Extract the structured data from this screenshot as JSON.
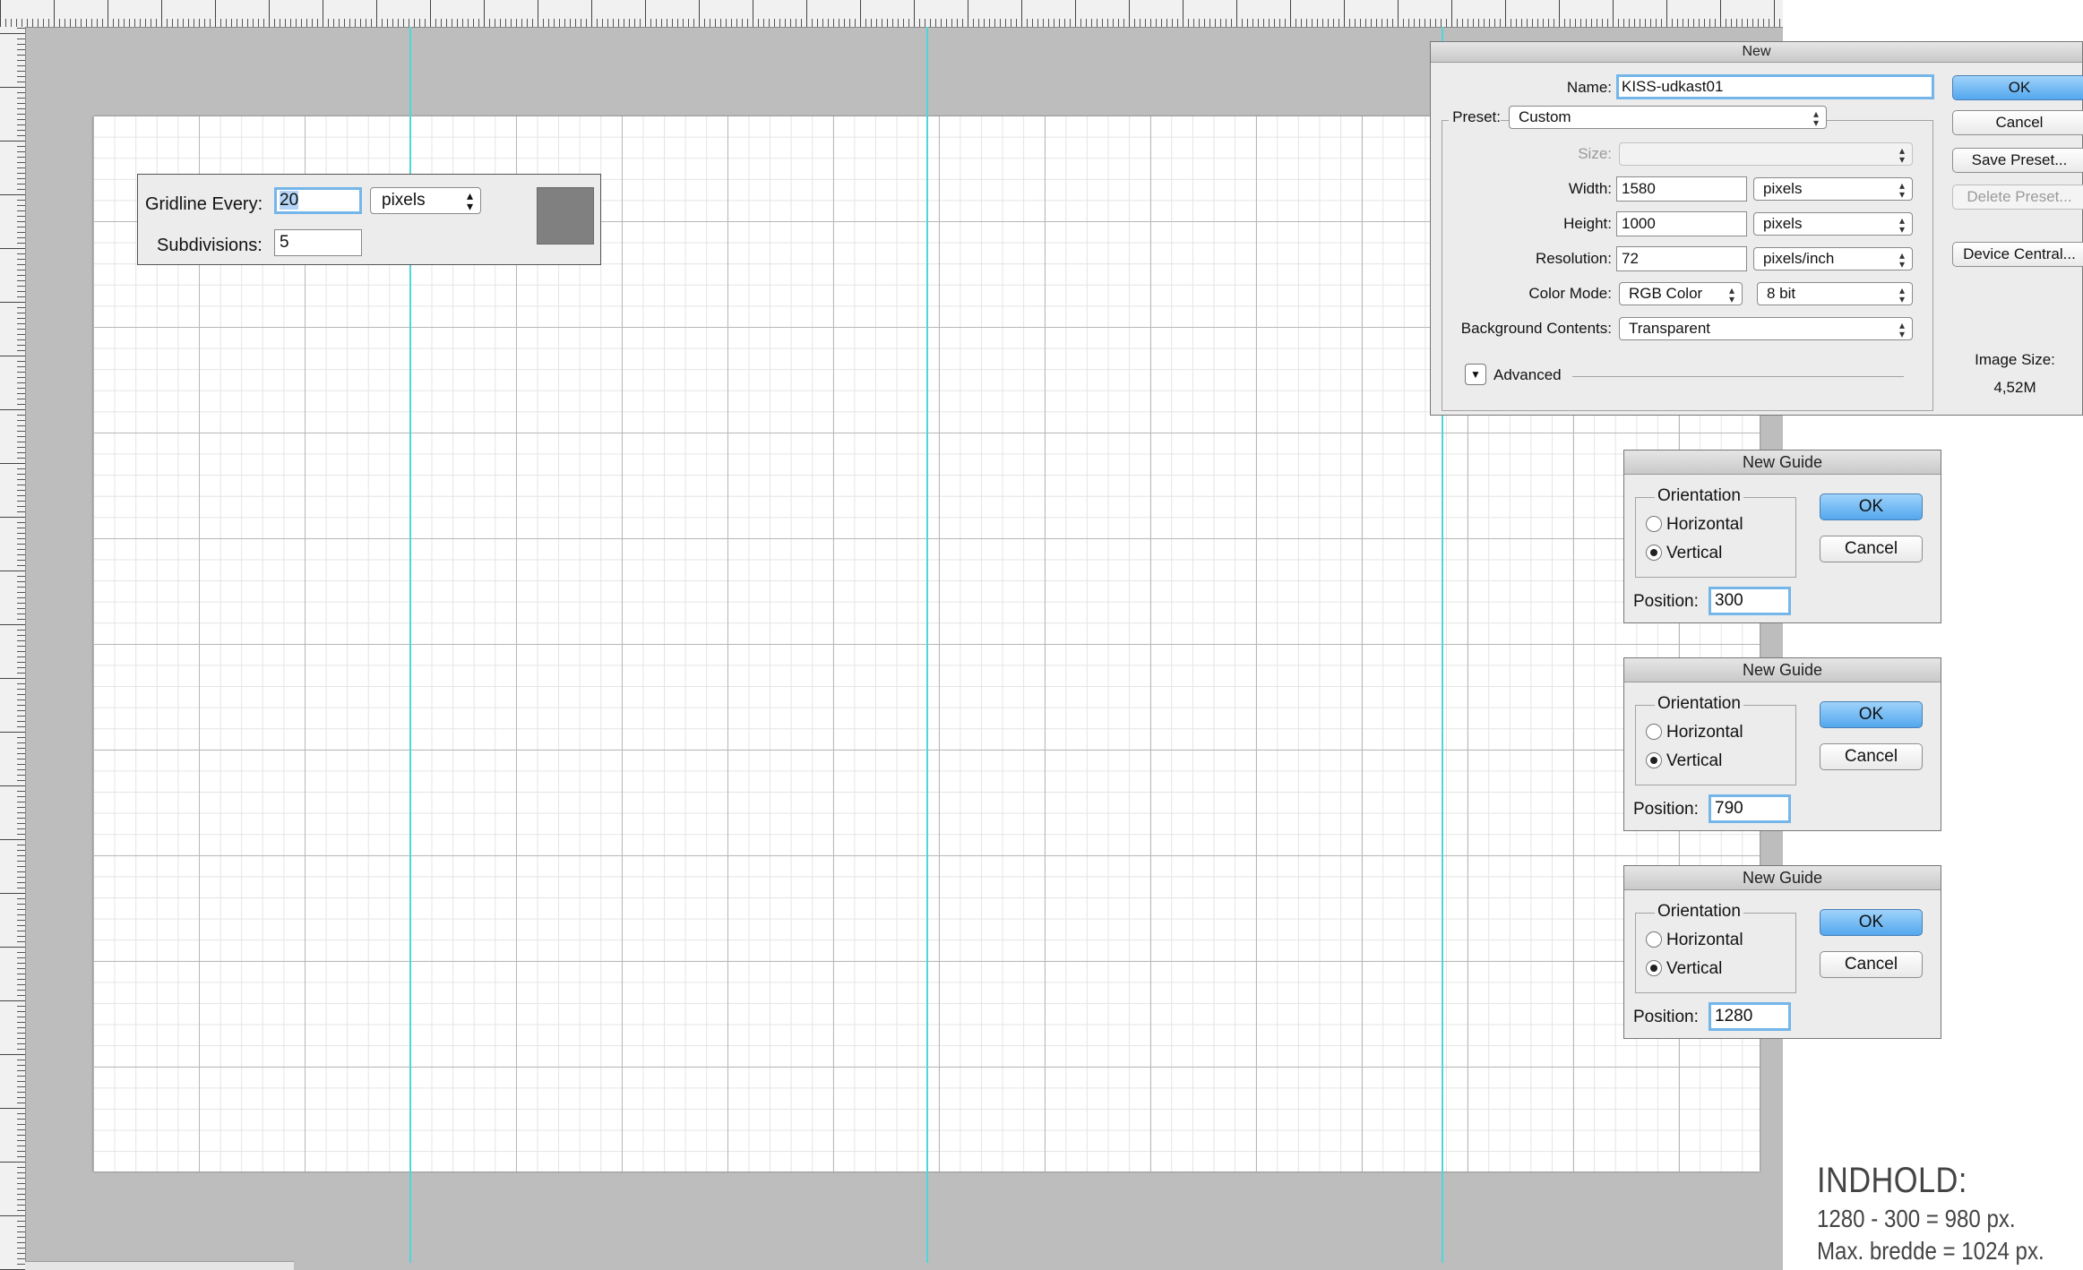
{
  "grid_panel": {
    "gridline_label": "Gridline Every:",
    "gridline_value": "20",
    "unit": "pixels",
    "subdivisions_label": "Subdivisions:",
    "subdivisions_value": "5",
    "color": "#808080"
  },
  "new_dialog": {
    "title": "New",
    "name_label": "Name:",
    "name_value": "KISS-udkast01",
    "preset_label": "Preset:",
    "preset_value": "Custom",
    "size_label": "Size:",
    "width_label": "Width:",
    "width_value": "1580",
    "width_unit": "pixels",
    "height_label": "Height:",
    "height_value": "1000",
    "height_unit": "pixels",
    "resolution_label": "Resolution:",
    "resolution_value": "72",
    "resolution_unit": "pixels/inch",
    "color_mode_label": "Color Mode:",
    "color_mode_value": "RGB Color",
    "bit_depth": "8 bit",
    "background_label": "Background Contents:",
    "background_value": "Transparent",
    "advanced_label": "Advanced",
    "image_size_label": "Image Size:",
    "image_size_value": "4,52M",
    "ok": "OK",
    "cancel": "Cancel",
    "save_preset": "Save Preset...",
    "delete_preset": "Delete Preset...",
    "device_central": "Device Central..."
  },
  "guide_dialogs": [
    {
      "title": "New Guide",
      "orientation_label": "Orientation",
      "horizontal": "Horizontal",
      "vertical": "Vertical",
      "selected": "vertical",
      "position_label": "Position:",
      "position_value": "300",
      "ok": "OK",
      "cancel": "Cancel"
    },
    {
      "title": "New Guide",
      "orientation_label": "Orientation",
      "horizontal": "Horizontal",
      "vertical": "Vertical",
      "selected": "vertical",
      "position_label": "Position:",
      "position_value": "790",
      "ok": "OK",
      "cancel": "Cancel"
    },
    {
      "title": "New Guide",
      "orientation_label": "Orientation",
      "horizontal": "Horizontal",
      "vertical": "Vertical",
      "selected": "vertical",
      "position_label": "Position:",
      "position_value": "1280",
      "ok": "OK",
      "cancel": "Cancel"
    }
  ],
  "notes": {
    "heading": "INDHOLD:",
    "line1": "1280 - 300 = 980 px.",
    "line2": "Max. bredde = 1024 px."
  },
  "colors": {
    "guide": "#4fd6dc",
    "focus_ring": "#74b6ea",
    "primary_button": "#53a7ee"
  }
}
